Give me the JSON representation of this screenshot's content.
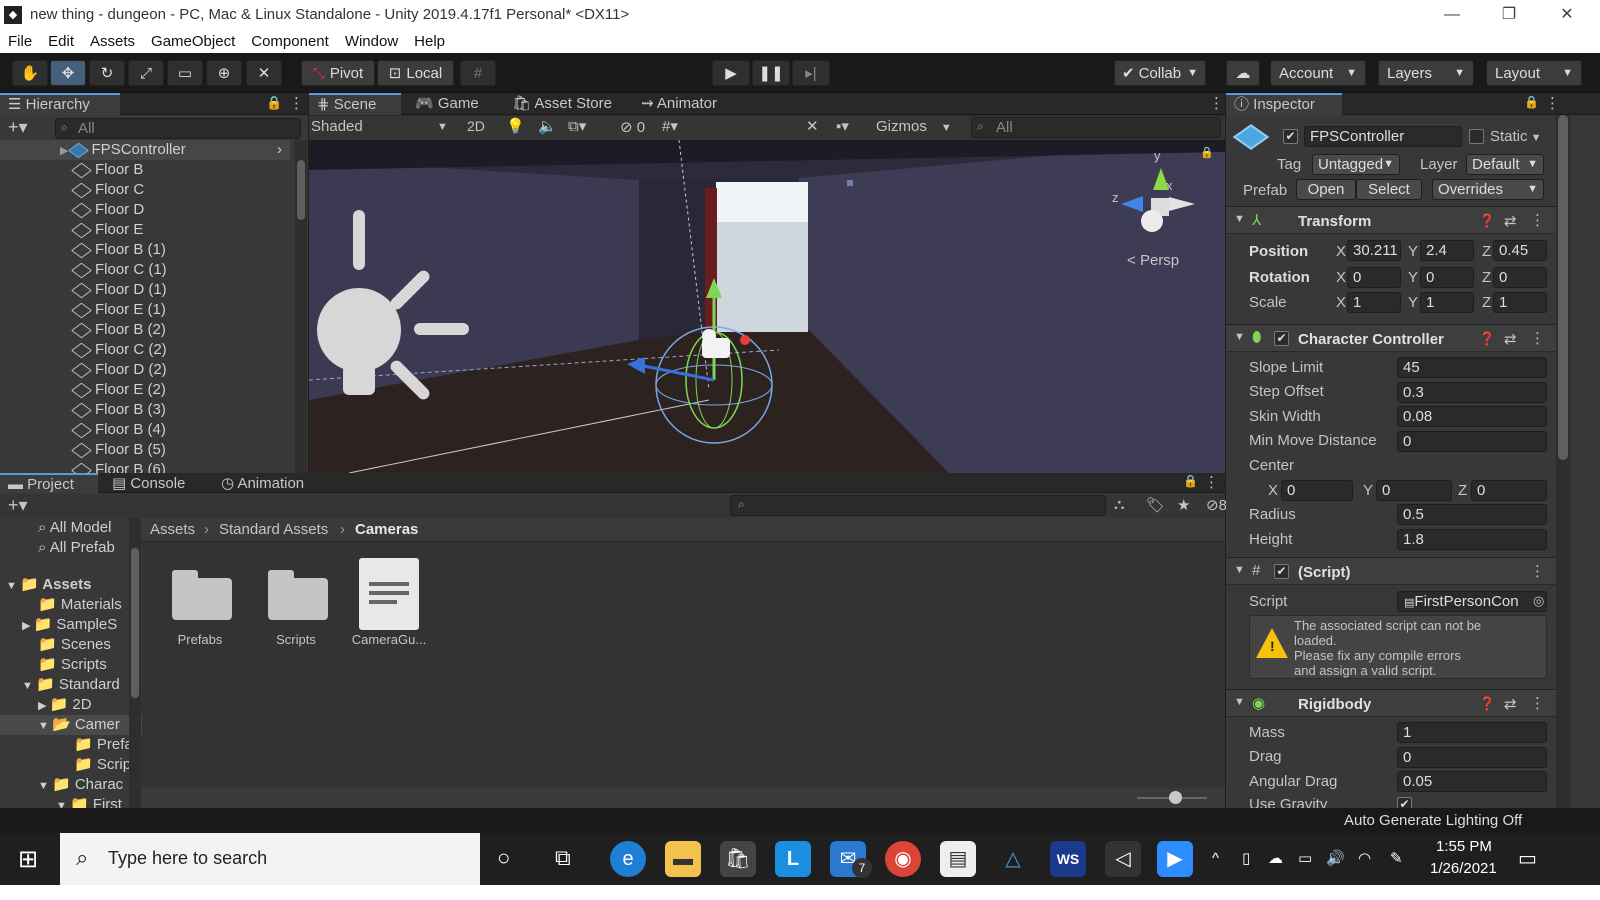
{
  "window": {
    "title": "new thing - dungeon - PC, Mac & Linux Standalone - Unity 2019.4.17f1 Personal* <DX11>",
    "minimize": "—",
    "maximize": "❐",
    "close": "✕"
  },
  "menu": [
    "File",
    "Edit",
    "Assets",
    "GameObject",
    "Component",
    "Window",
    "Help"
  ],
  "toolbar": {
    "pivot": "Pivot",
    "local": "Local",
    "collab": "Collab",
    "account": "Account",
    "layers": "Layers",
    "layout": "Layout"
  },
  "hierarchy": {
    "tab": "Hierarchy",
    "search_placeholder": "All",
    "items": [
      "FPSController",
      "Floor B",
      "Floor C",
      "Floor D",
      "Floor E",
      "Floor B (1)",
      "Floor C (1)",
      "Floor D (1)",
      "Floor E (1)",
      "Floor B (2)",
      "Floor C (2)",
      "Floor D (2)",
      "Floor E (2)",
      "Floor B (3)",
      "Floor B (4)",
      "Floor B (5)",
      "Floor B (6)"
    ]
  },
  "scene": {
    "tabs": [
      "Scene",
      "Game",
      "Asset Store",
      "Animator"
    ],
    "shading": "Shaded",
    "mode2d": "2D",
    "hidden_count": "0",
    "gizmos": "Gizmos",
    "search_placeholder": "All",
    "persp": "Persp",
    "axis_y": "y",
    "axis_x": "x",
    "axis_z": "z"
  },
  "project": {
    "tabs": [
      "Project",
      "Console",
      "Animation"
    ],
    "badge": "8",
    "favorites": [
      "All Model",
      "All Prefab"
    ],
    "tree": [
      {
        "label": "Assets",
        "bold": true
      },
      {
        "label": "Materials"
      },
      {
        "label": "SampleS"
      },
      {
        "label": "Scenes"
      },
      {
        "label": "Scripts"
      },
      {
        "label": "Standard"
      },
      {
        "label": "2D"
      },
      {
        "label": "Camer"
      },
      {
        "label": "Prefa"
      },
      {
        "label": "Scrip"
      },
      {
        "label": "Charac"
      },
      {
        "label": "First"
      }
    ],
    "breadcrumb": [
      "Assets",
      "Standard Assets",
      "Cameras"
    ],
    "files": [
      "Prefabs",
      "Scripts",
      "CameraGu..."
    ]
  },
  "inspector": {
    "tab": "Inspector",
    "object_name": "FPSController",
    "static": "Static",
    "tag_label": "Tag",
    "tag_value": "Untagged",
    "layer_label": "Layer",
    "layer_value": "Default",
    "prefab_label": "Prefab",
    "open": "Open",
    "select": "Select",
    "overrides": "Overrides",
    "transform": {
      "title": "Transform",
      "position_label": "Position",
      "rotation_label": "Rotation",
      "scale_label": "Scale",
      "x": "X",
      "y": "Y",
      "z": "Z",
      "position": [
        "30.211",
        "2.4",
        "0.45"
      ],
      "rotation": [
        "0",
        "0",
        "0"
      ],
      "scale": [
        "1",
        "1",
        "1"
      ]
    },
    "character_controller": {
      "title": "Character Controller",
      "fields": [
        {
          "label": "Slope Limit",
          "value": "45"
        },
        {
          "label": "Step Offset",
          "value": "0.3"
        },
        {
          "label": "Skin Width",
          "value": "0.08"
        },
        {
          "label": "Min Move Distance",
          "value": "0"
        }
      ],
      "center_label": "Center",
      "center": [
        "0",
        "0",
        "0"
      ],
      "radius_label": "Radius",
      "radius": "0.5",
      "height_label": "Height",
      "height": "1.8"
    },
    "script": {
      "title": "(Script)",
      "script_label": "Script",
      "script_value": "FirstPersonCon",
      "warning": [
        "The associated script can not be",
        "loaded.",
        "Please fix any compile errors",
        "and assign a valid script."
      ]
    },
    "rigidbody": {
      "title": "Rigidbody",
      "fields": [
        {
          "label": "Mass",
          "value": "1"
        },
        {
          "label": "Drag",
          "value": "0"
        },
        {
          "label": "Angular Drag",
          "value": "0.05"
        }
      ],
      "use_gravity": "Use Gravity"
    }
  },
  "status": "Auto Generate Lighting Off",
  "taskbar": {
    "search_placeholder": "Type here to search",
    "time": "1:55 PM",
    "date": "1/26/2021",
    "mail_badge": "7"
  }
}
